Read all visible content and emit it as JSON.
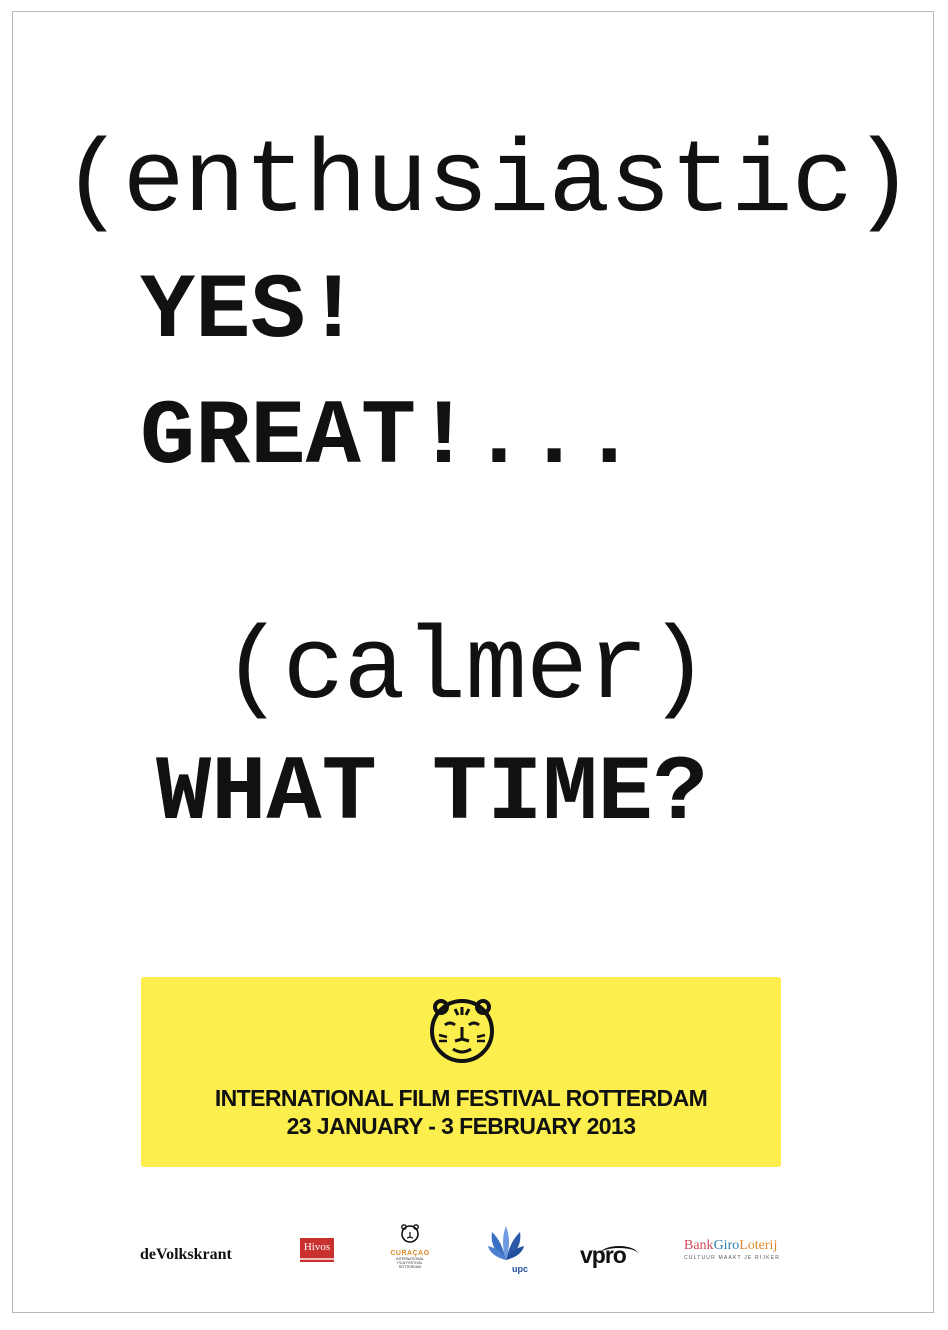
{
  "poster": {
    "lines": {
      "enthusiastic": "(enthusiastic)",
      "yes": "YES!",
      "great": "GREAT!...",
      "calmer": "(calmer)",
      "what_time": "WHAT TIME?"
    }
  },
  "festival": {
    "name": "INTERNATIONAL FILM FESTIVAL ROTTERDAM",
    "dates": "23 JANUARY - 3 FEBRUARY 2013",
    "logo_icon": "tiger-icon",
    "background_color": "#fcef4d"
  },
  "sponsors": {
    "volkskrant": "deVolkskrant",
    "hivos": "Hivos",
    "curacao": "CURAÇAO",
    "curacao_sub": [
      "INTERNATIONAL",
      "FILM FESTIVAL",
      "ROTTERDAM"
    ],
    "upc": "upc",
    "vpro": "vpro",
    "bank_part1": "Bank",
    "bank_part2": "Giro",
    "bank_part3": "Loterij",
    "bank_tagline": "CULTUUR MAAKT JE RIJKER"
  }
}
